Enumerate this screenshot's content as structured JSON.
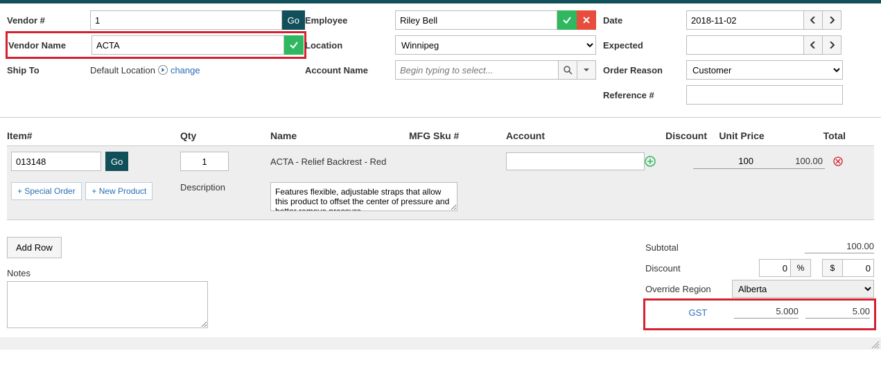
{
  "header": {
    "vendor_num_label": "Vendor #",
    "vendor_num_value": "1",
    "go_label": "Go",
    "vendor_name_label": "Vendor Name",
    "vendor_name_value": "ACTA",
    "ship_to_label": "Ship To",
    "ship_to_value": "Default Location",
    "change_label": "change",
    "employee_label": "Employee",
    "employee_value": "Riley Bell",
    "location_label": "Location",
    "location_value": "Winnipeg",
    "account_name_label": "Account Name",
    "account_name_placeholder": "Begin typing to select...",
    "date_label": "Date",
    "date_value": "2018-11-02",
    "expected_label": "Expected",
    "expected_value": "",
    "order_reason_label": "Order Reason",
    "order_reason_value": "Customer",
    "reference_label": "Reference #",
    "reference_value": ""
  },
  "items": {
    "headers": {
      "item": "Item#",
      "qty": "Qty",
      "name": "Name",
      "mfg": "MFG Sku #",
      "account": "Account",
      "discount": "Discount",
      "unit_price": "Unit Price",
      "total": "Total"
    },
    "row": {
      "item_value": "013148",
      "go_label": "Go",
      "qty_value": "1",
      "name_value": "ACTA - Relief Backrest - Red",
      "price_value": "100",
      "total_value": "100.00"
    },
    "special_order_label": "Special Order",
    "new_product_label": "New Product",
    "description_label": "Description",
    "description_value": "Features flexible, adjustable straps that allow this product to offset the center of pressure and better remove pressure"
  },
  "footer": {
    "add_row_label": "Add Row",
    "notes_label": "Notes",
    "subtotal_label": "Subtotal",
    "subtotal_value": "100.00",
    "discount_label": "Discount",
    "discount_pct_value": "0",
    "discount_amt_value": "0",
    "pct_symbol": "%",
    "dollar_symbol": "$",
    "override_region_label": "Override Region",
    "override_region_value": "Alberta",
    "tax_name": "GST",
    "tax_rate": "5.000",
    "tax_amount": "5.00"
  }
}
